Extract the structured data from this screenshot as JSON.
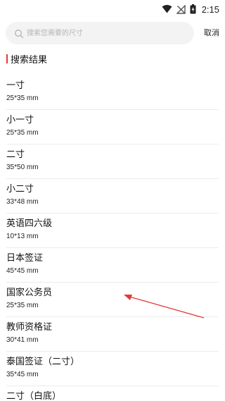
{
  "status_bar": {
    "time": "2:15",
    "icons": [
      "wifi-icon",
      "no-signal-icon",
      "battery-icon"
    ]
  },
  "search": {
    "placeholder": "搜索您需要的尺寸",
    "value": "",
    "cancel_label": "取消"
  },
  "results": {
    "title": "搜索结果",
    "accent_color": "#e53935",
    "items": [
      {
        "name": "一寸",
        "size": "25*35 mm"
      },
      {
        "name": "小一寸",
        "size": "25*35 mm"
      },
      {
        "name": "二寸",
        "size": "35*50 mm"
      },
      {
        "name": "小二寸",
        "size": "33*48 mm"
      },
      {
        "name": "英语四六级",
        "size": "10*13 mm"
      },
      {
        "name": "日本签证",
        "size": "45*45 mm"
      },
      {
        "name": "国家公务员",
        "size": "25*35 mm"
      },
      {
        "name": "教师资格证",
        "size": "30*41 mm"
      },
      {
        "name": "泰国签证（二寸）",
        "size": "35*45 mm"
      },
      {
        "name": "二寸（白底）",
        "size": ""
      }
    ]
  },
  "annotation": {
    "arrow_color": "#e53935",
    "points_to": "国家公务员"
  }
}
